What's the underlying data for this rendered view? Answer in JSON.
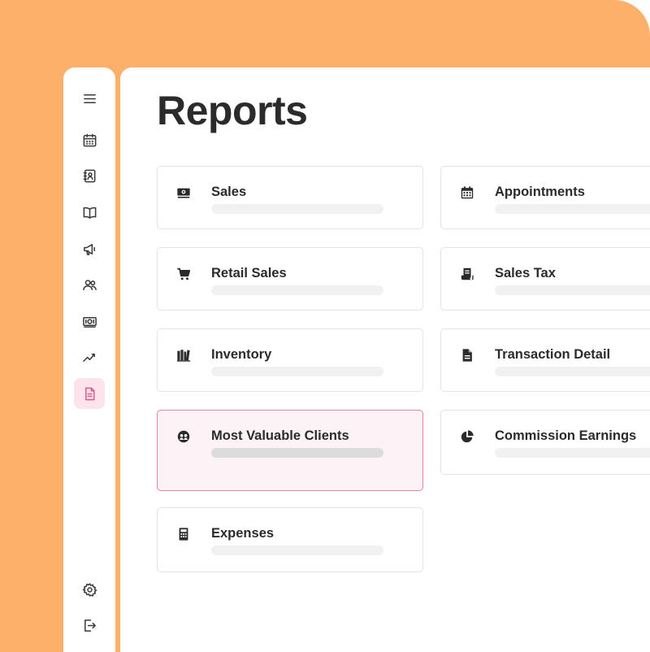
{
  "page": {
    "title": "Reports"
  },
  "colors": {
    "background": "#FDB069",
    "accent": "#E0588C",
    "highlight_bg": "#FDF2F6",
    "highlight_border": "#EB7FA6"
  },
  "sidebar": {
    "items": [
      {
        "icon": "menu-icon"
      },
      {
        "icon": "calendar-icon"
      },
      {
        "icon": "contacts-book-icon"
      },
      {
        "icon": "open-book-icon"
      },
      {
        "icon": "megaphone-icon"
      },
      {
        "icon": "users-icon"
      },
      {
        "icon": "money-icon"
      },
      {
        "icon": "trend-line-icon"
      },
      {
        "icon": "report-document-icon",
        "active": true
      },
      {
        "icon": "gear-icon"
      },
      {
        "icon": "logout-icon"
      }
    ]
  },
  "reports": [
    {
      "label": "Sales",
      "icon": "money-icon"
    },
    {
      "label": "Appointments",
      "icon": "calendar-icon"
    },
    {
      "label": "Retail Sales",
      "icon": "cart-icon"
    },
    {
      "label": "Sales Tax",
      "icon": "receipt-icon"
    },
    {
      "label": "Inventory",
      "icon": "inventory-icon"
    },
    {
      "label": "Transaction Detail",
      "icon": "document-icon"
    },
    {
      "label": "Most Valuable Clients",
      "icon": "clients-icon",
      "highlighted": true
    },
    {
      "label": "Commission Earnings",
      "icon": "pie-chart-icon"
    },
    {
      "label": "Expenses",
      "icon": "calculator-icon"
    }
  ]
}
